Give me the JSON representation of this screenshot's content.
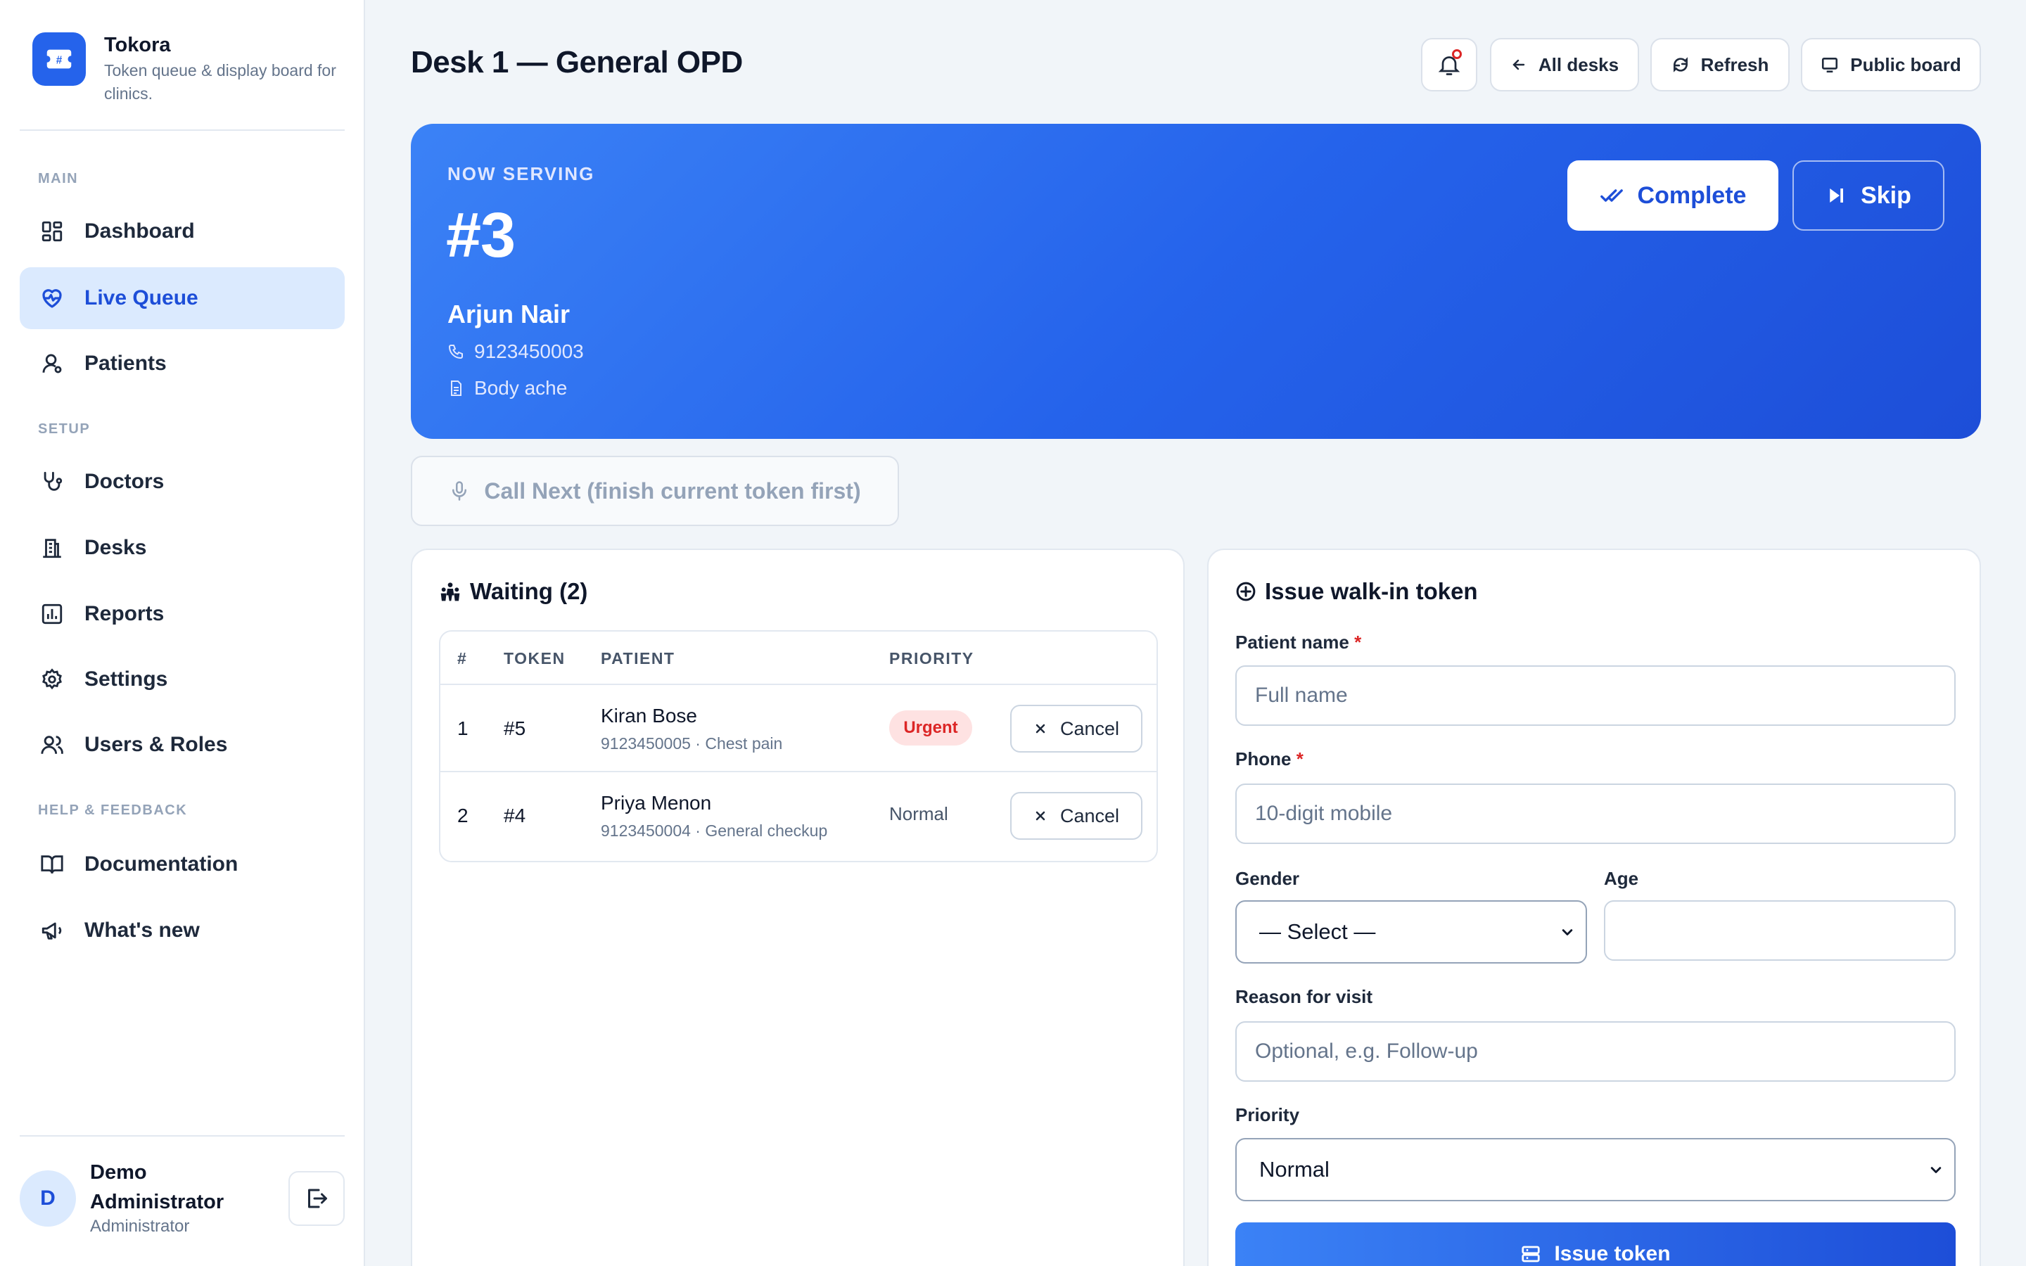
{
  "brand": {
    "name": "Tokora",
    "tagline": "Token queue & display board for clinics."
  },
  "sidebar": {
    "sections": [
      "MAIN",
      "SETUP",
      "HELP & FEEDBACK"
    ],
    "items": [
      {
        "label": "Dashboard",
        "icon": "dashboard-icon"
      },
      {
        "label": "Live Queue",
        "icon": "heart-pulse-icon",
        "active": true
      },
      {
        "label": "Patients",
        "icon": "user-icon"
      },
      {
        "label": "Doctors",
        "icon": "stethoscope-icon"
      },
      {
        "label": "Desks",
        "icon": "desk-icon"
      },
      {
        "label": "Reports",
        "icon": "bar-chart-icon"
      },
      {
        "label": "Settings",
        "icon": "gear-icon"
      },
      {
        "label": "Users & Roles",
        "icon": "users-icon"
      },
      {
        "label": "Documentation",
        "icon": "book-icon"
      },
      {
        "label": "What's new",
        "icon": "megaphone-icon"
      }
    ],
    "user": {
      "initial": "D",
      "name": "Demo Administrator",
      "role": "Administrator"
    }
  },
  "header": {
    "title": "Desk 1 — General OPD",
    "all_desks": "All desks",
    "refresh": "Refresh",
    "public_board": "Public board"
  },
  "serving": {
    "label": "NOW SERVING",
    "token": "#3",
    "name": "Arjun Nair",
    "phone": "9123450003",
    "reason": "Body ache",
    "complete": "Complete",
    "skip": "Skip"
  },
  "call_next": "Call Next (finish current token first)",
  "waiting": {
    "title": "Waiting (2)",
    "columns": [
      "#",
      "TOKEN",
      "PATIENT",
      "PRIORITY"
    ],
    "rows": [
      {
        "n": "1",
        "token": "#5",
        "name": "Kiran Bose",
        "sub": "9123450005 · Chest pain",
        "priority": "Urgent",
        "action": "Cancel"
      },
      {
        "n": "2",
        "token": "#4",
        "name": "Priya Menon",
        "sub": "9123450004 · General checkup",
        "priority": "Normal",
        "action": "Cancel"
      }
    ]
  },
  "form": {
    "title": "Issue walk-in token",
    "name_label": "Patient name",
    "name_placeholder": "Full name",
    "phone_label": "Phone",
    "phone_placeholder": "10-digit mobile",
    "required_mark": "*",
    "gender_label": "Gender",
    "gender_value": "— Select —",
    "age_label": "Age",
    "age_value": "",
    "reason_label": "Reason for visit",
    "reason_placeholder": "Optional, e.g. Follow-up",
    "priority_label": "Priority",
    "priority_value": "Normal",
    "submit": "Issue token"
  },
  "colors": {
    "accent": "#2563eb",
    "accent_dark": "#1d4ed8",
    "urgent": "#dc2626",
    "urgent_bg": "#fee2e2"
  }
}
